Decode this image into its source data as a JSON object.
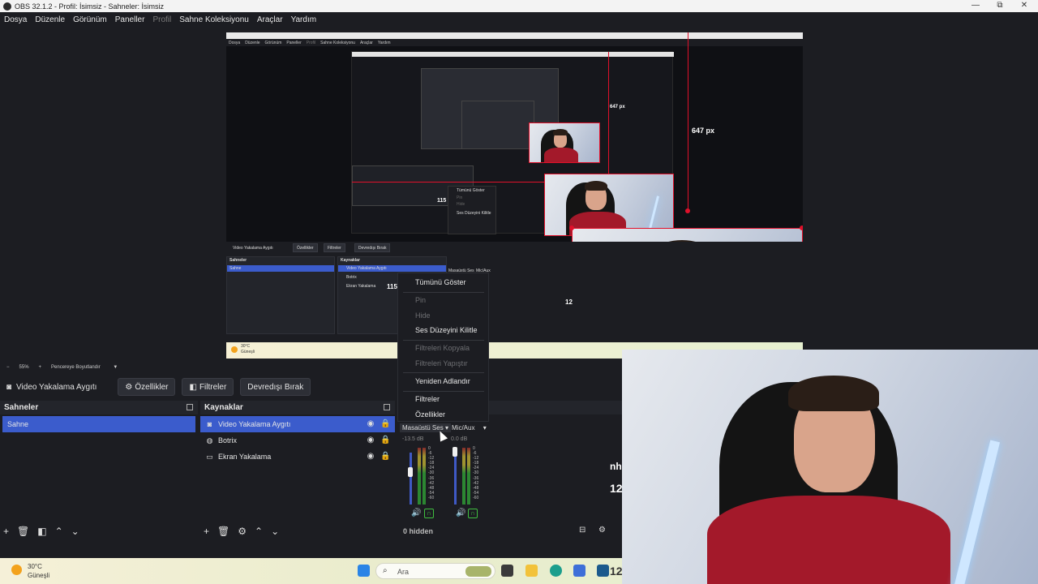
{
  "window": {
    "title": "OBS 32.1.2 - Profil: İsimsiz - Sahneler: İsimsiz",
    "controls": {
      "minimize": "—",
      "maximize": "⧉",
      "close": "✕"
    }
  },
  "menu": [
    "Dosya",
    "Düzenle",
    "Görünüm",
    "Paneller",
    "Profil",
    "Sahne Koleksiyonu",
    "Araçlar",
    "Yardım"
  ],
  "preview": {
    "measure_main": "647 px",
    "measure_small": "647 px",
    "nested_menu": [
      "Dosya",
      "Düzenle",
      "Görünüm",
      "Paneller",
      "Profil",
      "Sahne Koleksiyonu",
      "Araçlar",
      "Yardım"
    ],
    "nested": {
      "source_toolbar": [
        "Video Yakalama Aygıtı",
        "Özellikler",
        "Filtreler",
        "Devredışı Bırak"
      ],
      "scenes_title": "Sahneler",
      "scene": "Sahne",
      "sources_title": "Kaynaklar",
      "sources": [
        "Video Yakalama Aygıtı",
        "Botrix",
        "Ekran Yakalama"
      ],
      "overlay_number": "115",
      "context_items": [
        "Tümünü Göster",
        "Pin",
        "Hide",
        "Ses Düzeyini Kilitle",
        "Filtreleri Kopyala",
        "Filtreleri Yapıştır",
        "Yeniden Adlandır",
        "Filtreler",
        "Özellikler"
      ],
      "mixer_label": "Masaüstü Ses",
      "mixer_label2": "Mic/Aux",
      "side_number": "12",
      "weather_temp": "30°C",
      "weather_desc": "Güneşli"
    }
  },
  "zoom": {
    "minus": "−",
    "value": "55%",
    "plus": "+",
    "mode": "Pencereye Boyutlandır"
  },
  "source_toolbar": {
    "source_name": "Video Yakalama Aygıtı",
    "properties": "Özellikler",
    "filters": "Filtreler",
    "disable": "Devredışı Bırak"
  },
  "scenes": {
    "title": "Sahneler",
    "items": [
      {
        "label": "Sahne",
        "selected": true
      }
    ]
  },
  "sources": {
    "title": "Kaynaklar",
    "items": [
      {
        "label": "Video Yakalama Aygıtı",
        "icon": "camera-icon",
        "selected": true
      },
      {
        "label": "Botrix",
        "icon": "globe-icon",
        "selected": false
      },
      {
        "label": "Ekran Yakalama",
        "icon": "monitor-icon",
        "selected": false
      }
    ]
  },
  "mixer": {
    "channels": [
      {
        "name": "Masaüstü Ses",
        "db": "-13.5 dB",
        "level": 0.55
      },
      {
        "name": "Mic/Aux",
        "db": "0.0 dB",
        "level": 0.7
      }
    ],
    "scale": [
      "0",
      "-6",
      "-12",
      "-18",
      "-24",
      "-30",
      "-36",
      "-42",
      "-48",
      "-54",
      "-60"
    ],
    "hidden_text": "0 hidden"
  },
  "context_menu": {
    "items": [
      {
        "label": "Tümünü Göster",
        "enabled": true
      },
      {
        "label": "Pin",
        "enabled": false
      },
      {
        "label": "Hide",
        "enabled": false
      },
      {
        "label": "Ses Düzeyini Kilitle",
        "enabled": true
      },
      {
        "label": "Filtreleri Kopyala",
        "enabled": false
      },
      {
        "label": "Filtreleri Yapıştır",
        "enabled": false
      },
      {
        "label": "Yeniden Adlandır",
        "enabled": true
      },
      {
        "label": "Filtreler",
        "enabled": true
      },
      {
        "label": "Özellikler",
        "enabled": true
      }
    ]
  },
  "right_edge": {
    "partial_text": "nh",
    "number": "12"
  },
  "taskbar": {
    "temp": "30°C",
    "weather": "Güneşli",
    "search_placeholder": "Ara",
    "clock": "12"
  },
  "colors": {
    "accent": "#3b5ccc",
    "selection_red": "#e0102a",
    "bg": "#1c1d22",
    "panel": "#23252b"
  }
}
